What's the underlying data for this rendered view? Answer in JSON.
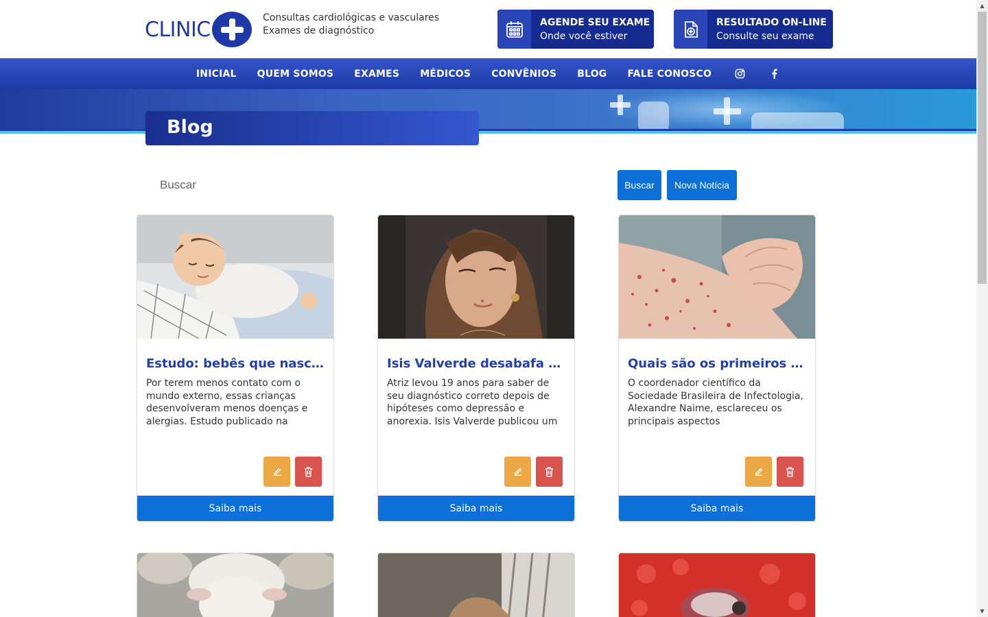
{
  "header": {
    "logo_text": "CLINIC",
    "tagline_line1": "Consultas cardiológicas e vasculares",
    "tagline_line2": "Exames de diagnóstico",
    "cta_exam": {
      "title": "AGENDE SEU EXAME",
      "subtitle": "Onde você estiver",
      "icon": "calendar-icon"
    },
    "cta_result": {
      "title": "RESULTADO ON-LINE",
      "subtitle": "Consulte seu exame",
      "icon": "medical-file-icon"
    }
  },
  "nav": {
    "items": [
      "INICIAL",
      "QUEM SOMOS",
      "EXAMES",
      "MÉDICOS",
      "CONVÊNIOS",
      "BLOG",
      "FALE CONOSCO"
    ],
    "icons": [
      "instagram-icon",
      "facebook-icon"
    ]
  },
  "page": {
    "title": "Blog"
  },
  "search": {
    "placeholder": "Buscar",
    "value": "",
    "button_label": "Buscar",
    "new_button_label": "Nova Notícia"
  },
  "posts": [
    {
      "title": "Estudo: bebês que nascer...",
      "description": "Por terem menos contato com o mundo externo, essas crianças desenvolveram menos doenças e alergias. Estudo publicado na",
      "image": "sleeping-baby-photo",
      "more_label": "Saiba mais"
    },
    {
      "title": "Isis Valverde desabafa so...",
      "description": "Atriz levou 19 anos para saber de seu diagnóstico correto depois de hipóteses como depressão e anorexia. Isis Valverde publicou um",
      "image": "woman-portrait-photo",
      "more_label": "Saiba mais"
    },
    {
      "title": "Quais são os primeiros sin...",
      "description": "O coordenador científico da Sociedade Brasileira de Infectologia, Alexandre Naime, esclareceu os principais aspectos",
      "image": "skin-rash-photo",
      "more_label": "Saiba mais"
    }
  ],
  "posts_row2_images": [
    "sheep-photo",
    "window-woman-photo",
    "red-tick-photo"
  ],
  "colors": {
    "brand_blue": "#1d3aa6",
    "button_blue": "#0c70d8",
    "edit_orange": "#eca844",
    "delete_red": "#d9534f",
    "title_blue": "#2140ad"
  }
}
